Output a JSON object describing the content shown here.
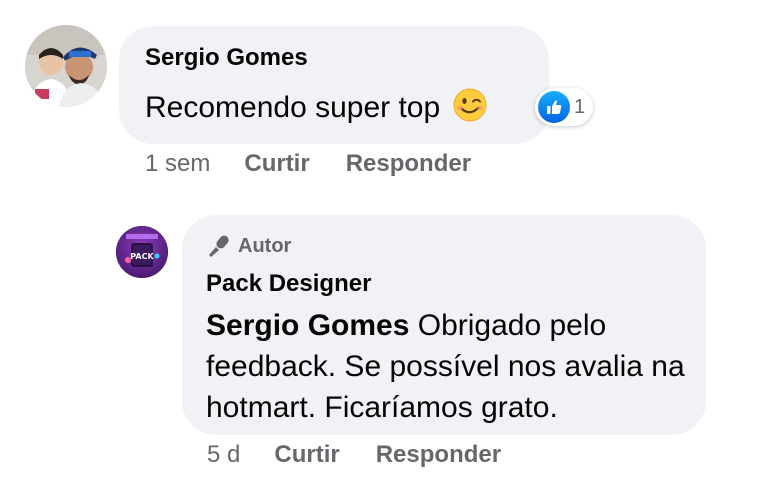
{
  "comments": [
    {
      "author": "Sergio Gomes",
      "text": "Recomendo super top",
      "emoji": "wink-emoji",
      "reaction": {
        "icon": "like-icon",
        "count": "1"
      },
      "time": "1 sem",
      "like_label": "Curtir",
      "reply_label": "Responder"
    },
    {
      "badge": "Autor",
      "author": "Pack Designer",
      "mention": "Sergio Gomes",
      "text": " Obrigado pelo feedback. Se possível nos avalia na hotmart. Ficaríamos grato.",
      "avatar_text": "PACK",
      "time": "5 d",
      "like_label": "Curtir",
      "reply_label": "Responder"
    }
  ],
  "colors": {
    "bubble": "#f0f2f5",
    "secondary_text": "#65676b",
    "like_blue": "#0866ff",
    "pack_avatar": "#6a2d8f"
  }
}
